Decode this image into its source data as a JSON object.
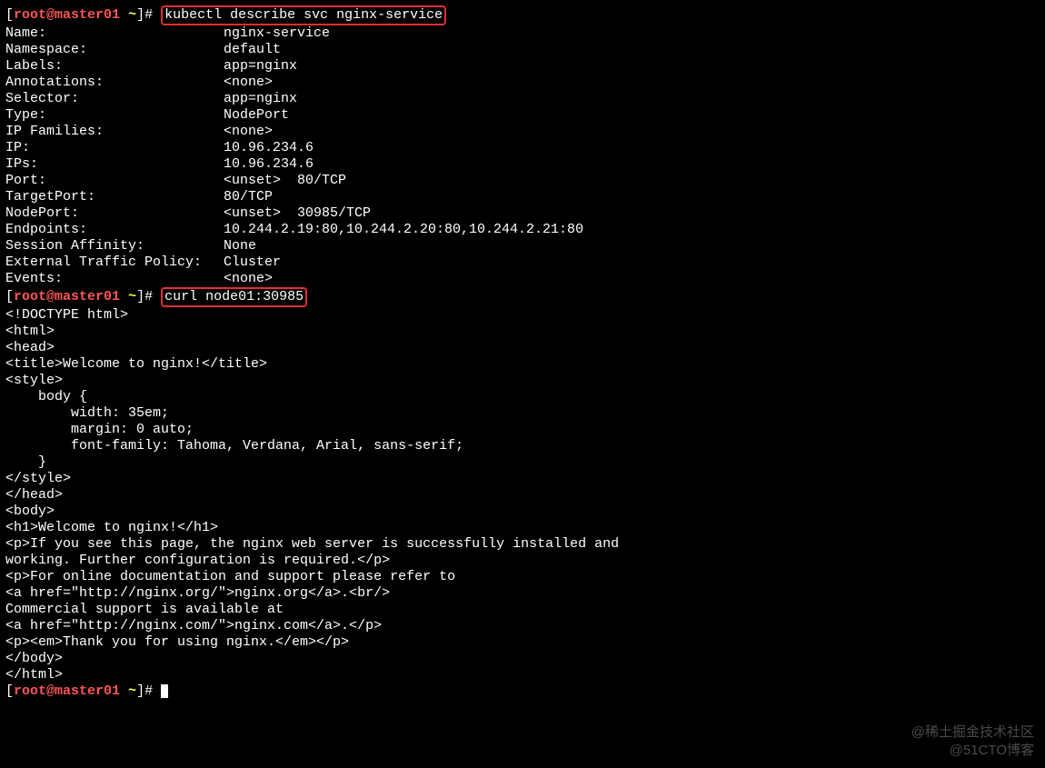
{
  "prompt": {
    "user_host": "root@master01",
    "sep": " ",
    "tilde": "~",
    "hash": "#"
  },
  "cmd1": "kubectl describe svc nginx-service",
  "cmd2": "curl node01:30985",
  "svc": {
    "k0": "Name:",
    "v0": "nginx-service",
    "k1": "Namespace:",
    "v1": "default",
    "k2": "Labels:",
    "v2": "app=nginx",
    "k3": "Annotations:",
    "v3": "<none>",
    "k4": "Selector:",
    "v4": "app=nginx",
    "k5": "Type:",
    "v5": "NodePort",
    "k6": "IP Families:",
    "v6": "<none>",
    "k7": "IP:",
    "v7": "10.96.234.6",
    "k8": "IPs:",
    "v8": "10.96.234.6",
    "k9": "Port:",
    "v9": "<unset>  80/TCP",
    "k10": "TargetPort:",
    "v10": "80/TCP",
    "k11": "NodePort:",
    "v11": "<unset>  30985/TCP",
    "k12": "Endpoints:",
    "v12": "10.244.2.19:80,10.244.2.20:80,10.244.2.21:80",
    "k13": "Session Affinity:",
    "v13": "None",
    "k14": "External Traffic Policy:",
    "v14": "Cluster",
    "k15": "Events:",
    "v15": "<none>"
  },
  "html_out": {
    "l0": "<!DOCTYPE html>",
    "l1": "<html>",
    "l2": "<head>",
    "l3": "<title>Welcome to nginx!</title>",
    "l4": "<style>",
    "l5": "    body {",
    "l6": "        width: 35em;",
    "l7": "        margin: 0 auto;",
    "l8": "        font-family: Tahoma, Verdana, Arial, sans-serif;",
    "l9": "    }",
    "l10": "</style>",
    "l11": "</head>",
    "l12": "<body>",
    "l13": "<h1>Welcome to nginx!</h1>",
    "l14": "<p>If you see this page, the nginx web server is successfully installed and",
    "l15": "working. Further configuration is required.</p>",
    "l16": "",
    "l17": "<p>For online documentation and support please refer to",
    "l18": "<a href=\"http://nginx.org/\">nginx.org</a>.<br/>",
    "l19": "Commercial support is available at",
    "l20": "<a href=\"http://nginx.com/\">nginx.com</a>.</p>",
    "l21": "",
    "l22": "<p><em>Thank you for using nginx.</em></p>",
    "l23": "</body>",
    "l24": "</html>"
  },
  "watermark": {
    "l1": "@稀土掘金技术社区",
    "l2": "@51CTO博客"
  }
}
